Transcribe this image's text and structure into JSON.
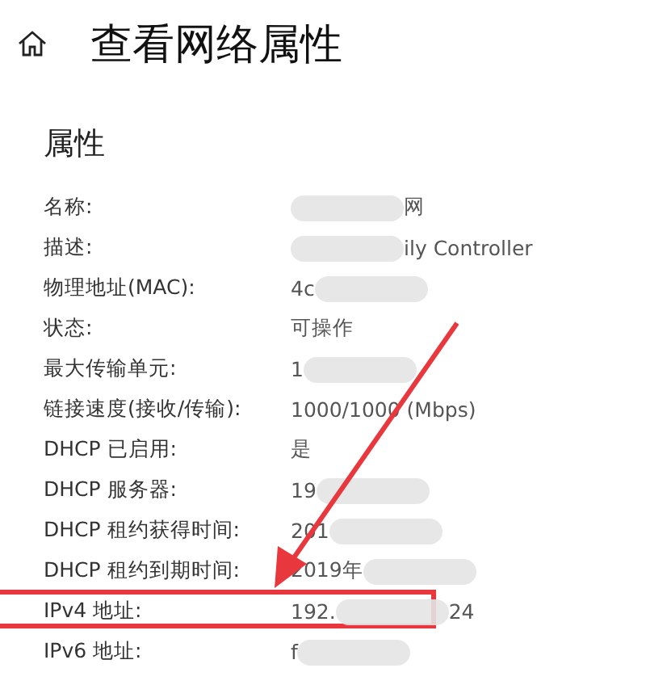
{
  "header": {
    "title": "查看网络属性"
  },
  "section": {
    "title": "属性"
  },
  "properties": [
    {
      "label": "名称:",
      "value_end": "网",
      "redacted": true,
      "highlighted": false
    },
    {
      "label": "描述:",
      "value_end": "ily Controller",
      "redacted": true,
      "highlighted": false
    },
    {
      "label": "物理地址(MAC):",
      "value_start": "4c",
      "redacted": true,
      "highlighted": false
    },
    {
      "label": "状态:",
      "value_start": "可操作",
      "redacted": false,
      "highlighted": false
    },
    {
      "label": "最大传输单元:",
      "value_start": "1",
      "redacted": true,
      "highlighted": false
    },
    {
      "label": "链接速度(接收/传输):",
      "value_start": "1000/1000 (Mbps)",
      "redacted": false,
      "highlighted": false
    },
    {
      "label": "DHCP 已启用:",
      "value_start": "是",
      "redacted": false,
      "highlighted": false
    },
    {
      "label": "DHCP 服务器:",
      "value_start": "19",
      "redacted": true,
      "highlighted": false
    },
    {
      "label": "DHCP 租约获得时间:",
      "value_start": "201",
      "redacted": true,
      "highlighted": false
    },
    {
      "label": "DHCP 租约到期时间:",
      "value_start": "2019年",
      "redacted": true,
      "highlighted": false
    },
    {
      "label": "IPv4 地址:",
      "value_start": "192.",
      "value_end": "24",
      "redacted": true,
      "highlighted": true
    },
    {
      "label": "IPv6 地址:",
      "value_start": "f",
      "redacted": true,
      "highlighted": false
    }
  ],
  "annotation": {
    "arrow": true
  }
}
